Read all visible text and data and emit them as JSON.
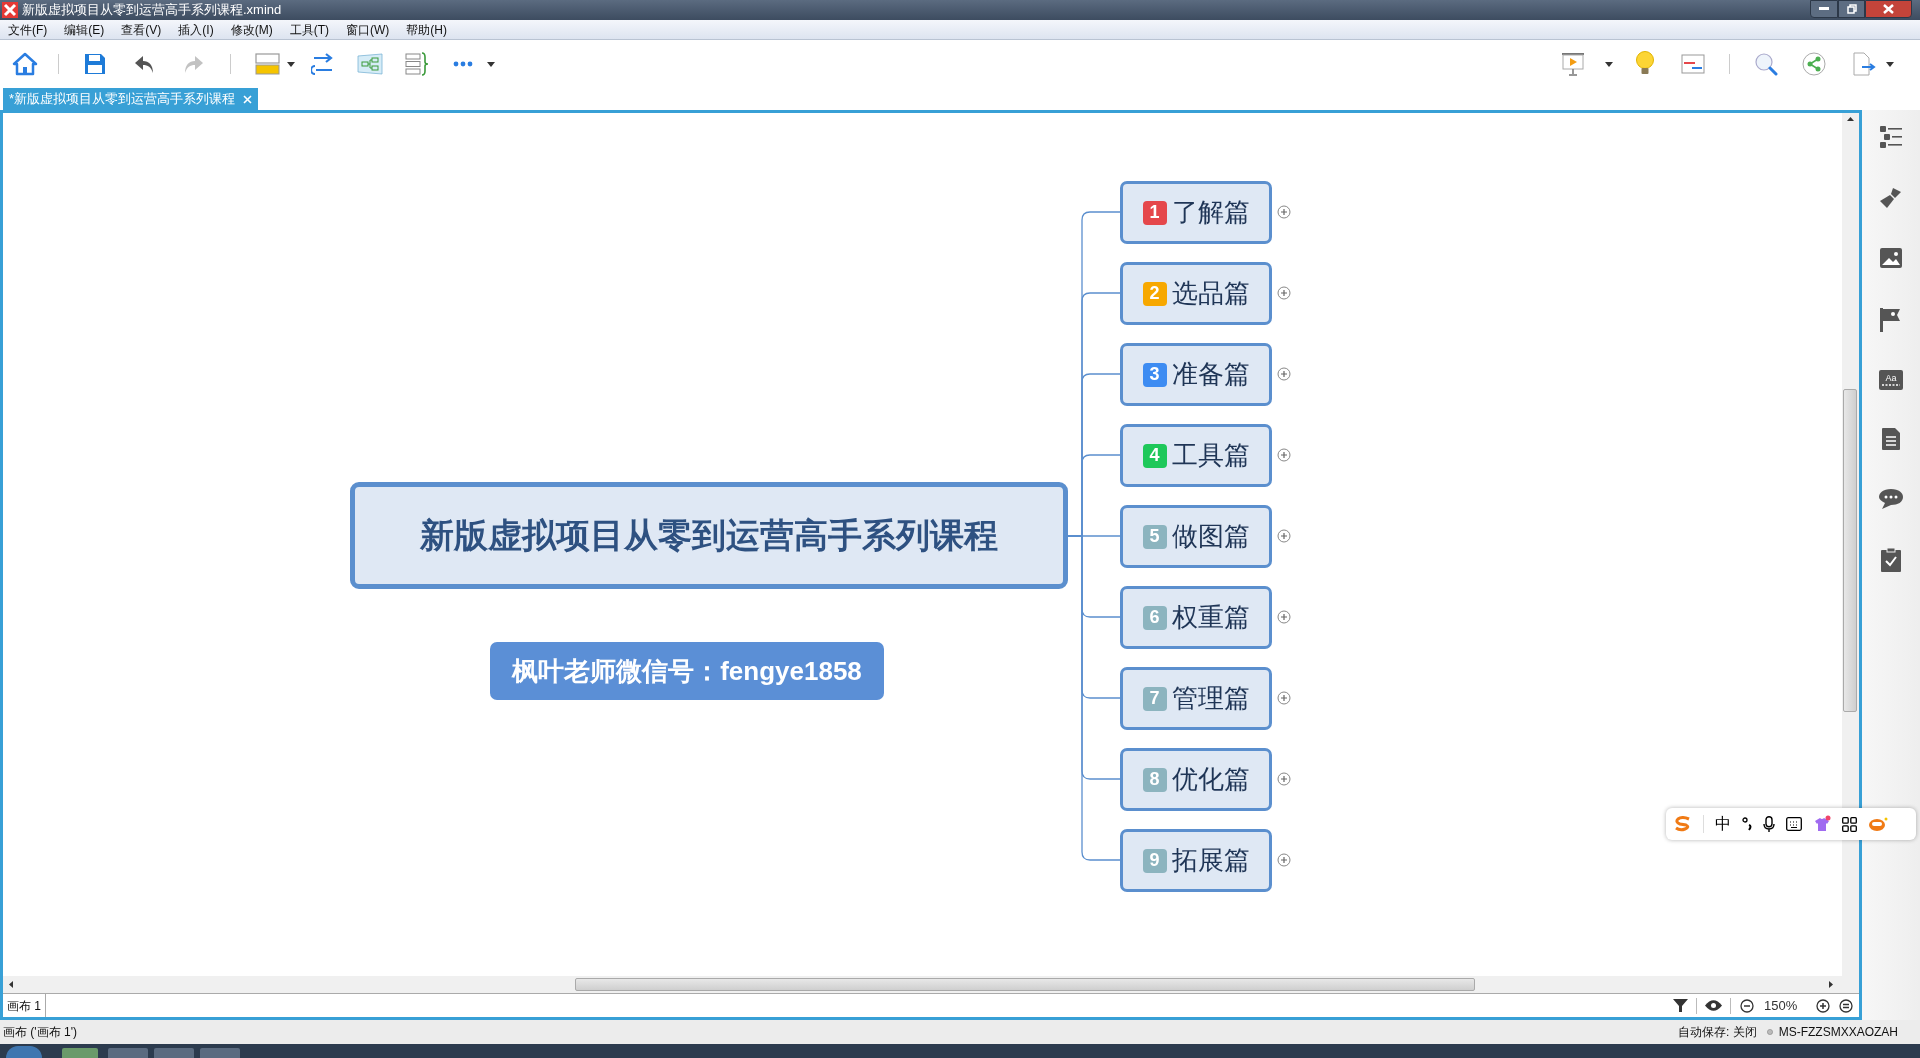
{
  "window": {
    "title": "新版虚拟项目从零到运营高手系列课程.xmind"
  },
  "menu": [
    "文件(F)",
    "编辑(E)",
    "查看(V)",
    "插入(I)",
    "修改(M)",
    "工具(T)",
    "窗口(W)",
    "帮助(H)"
  ],
  "tab": {
    "label": "*新版虚拟项目从零到运营高手系列课程",
    "selected": true
  },
  "mind_map": {
    "central_topic": "新版虚拟项目从零到运营高手系列课程",
    "subtopics": [
      {
        "number": "1",
        "label": "了解篇",
        "color": "#e5474b"
      },
      {
        "number": "2",
        "label": "选品篇",
        "color": "#f7a800"
      },
      {
        "number": "3",
        "label": "准备篇",
        "color": "#3d8cf2"
      },
      {
        "number": "4",
        "label": "工具篇",
        "color": "#1ec85a"
      },
      {
        "number": "5",
        "label": "做图篇",
        "color": "#8cb4bf"
      },
      {
        "number": "6",
        "label": "权重篇",
        "color": "#8cb4bf"
      },
      {
        "number": "7",
        "label": "管理篇",
        "color": "#8cb4bf"
      },
      {
        "number": "8",
        "label": "优化篇",
        "color": "#8cb4bf"
      },
      {
        "number": "9",
        "label": "拓展篇",
        "color": "#8cb4bf"
      }
    ],
    "floating_topic": "枫叶老师微信号：fengye1858"
  },
  "sheet_tabs": [
    {
      "label": "画布 1",
      "selected": true
    }
  ],
  "zoom": "150%",
  "status_bar": {
    "sheet": "画布 ('画布 1')",
    "autosave": "自动保存: 关闭",
    "computer": "MS-FZZSMXXAOZAH"
  },
  "ime": {
    "mode": "中"
  },
  "sidebar": {
    "text_icon_label": "Aa"
  }
}
